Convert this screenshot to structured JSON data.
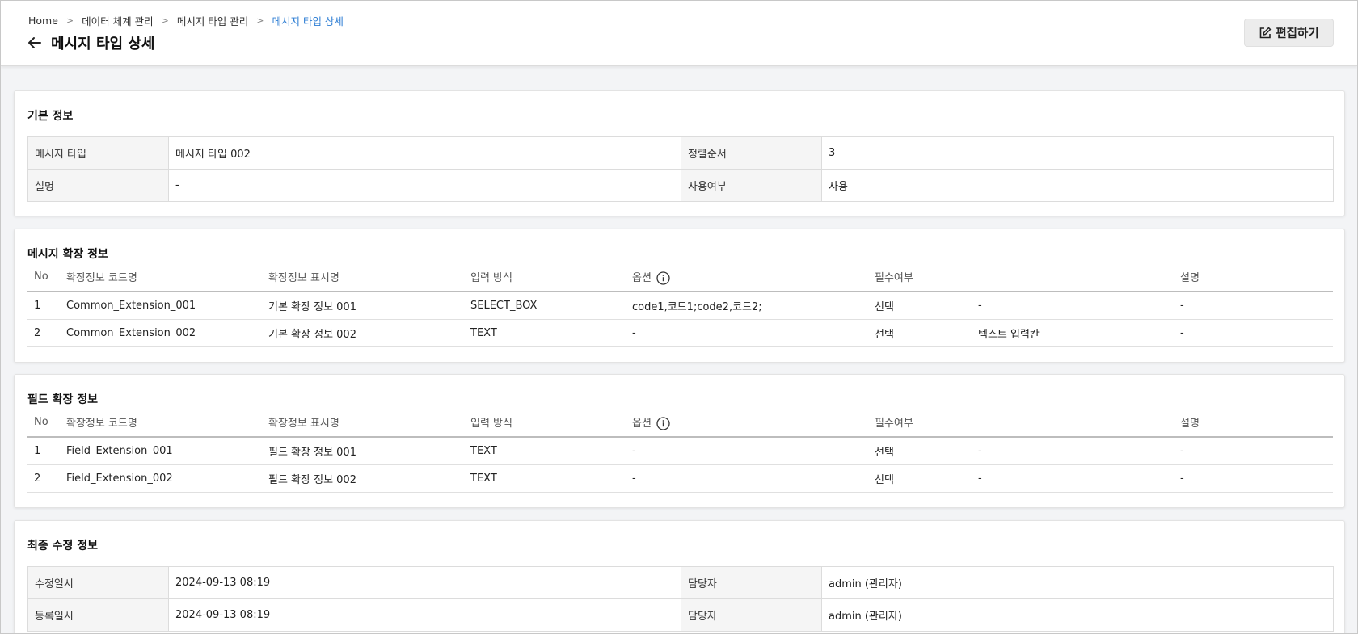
{
  "breadcrumb": [
    "Home",
    "데이터 체계 관리",
    "메시지 타입 관리",
    "메시지 타입 상세"
  ],
  "page_title": "메시지 타입 상세",
  "edit_button": "편집하기",
  "basic": {
    "title": "기본 정보",
    "rows": [
      {
        "l1": "메시지 타입",
        "v1": "메시지 타입 002",
        "l2": "정렬순서",
        "v2": "3"
      },
      {
        "l1": "설명",
        "v1": "-",
        "l2": "사용여부",
        "v2": "사용"
      }
    ]
  },
  "message_ext": {
    "title": "메시지 확장 정보",
    "headers": {
      "no": "No",
      "code": "확장정보 코드명",
      "display": "확장정보 표시명",
      "input": "입력 방식",
      "option": "옵션",
      "required": "필수여부",
      "desc": "설명"
    },
    "rows": [
      {
        "no": "1",
        "code": "Common_Extension_001",
        "display": "기본 확장 정보 001",
        "input": "SELECT_BOX",
        "option": "code1,코드1;code2,코드2;",
        "required": "선택",
        "extra": "-",
        "desc": "-"
      },
      {
        "no": "2",
        "code": "Common_Extension_002",
        "display": "기본 확장 정보 002",
        "input": "TEXT",
        "option": "-",
        "required": "선택",
        "extra": "텍스트 입력칸",
        "desc": "-"
      }
    ]
  },
  "field_ext": {
    "title": "필드 확장 정보",
    "headers": {
      "no": "No",
      "code": "확장정보 코드명",
      "display": "확장정보 표시명",
      "input": "입력 방식",
      "option": "옵션",
      "required": "필수여부",
      "desc": "설명"
    },
    "rows": [
      {
        "no": "1",
        "code": "Field_Extension_001",
        "display": "필드 확장 정보 001",
        "input": "TEXT",
        "option": "-",
        "required": "선택",
        "extra": "-",
        "desc": "-"
      },
      {
        "no": "2",
        "code": "Field_Extension_002",
        "display": "필드 확장 정보 002",
        "input": "TEXT",
        "option": "-",
        "required": "선택",
        "extra": "-",
        "desc": "-"
      }
    ]
  },
  "last_modified": {
    "title": "최종 수정 정보",
    "rows": [
      {
        "l1": "수정일시",
        "v1": "2024-09-13 08:19",
        "l2": "담당자",
        "v2": "admin (관리자)"
      },
      {
        "l1": "등록일시",
        "v1": "2024-09-13 08:19",
        "l2": "담당자",
        "v2": "admin (관리자)"
      }
    ]
  },
  "colors": {
    "accent": "#2b7cd3",
    "background": "#f3f4f6"
  }
}
